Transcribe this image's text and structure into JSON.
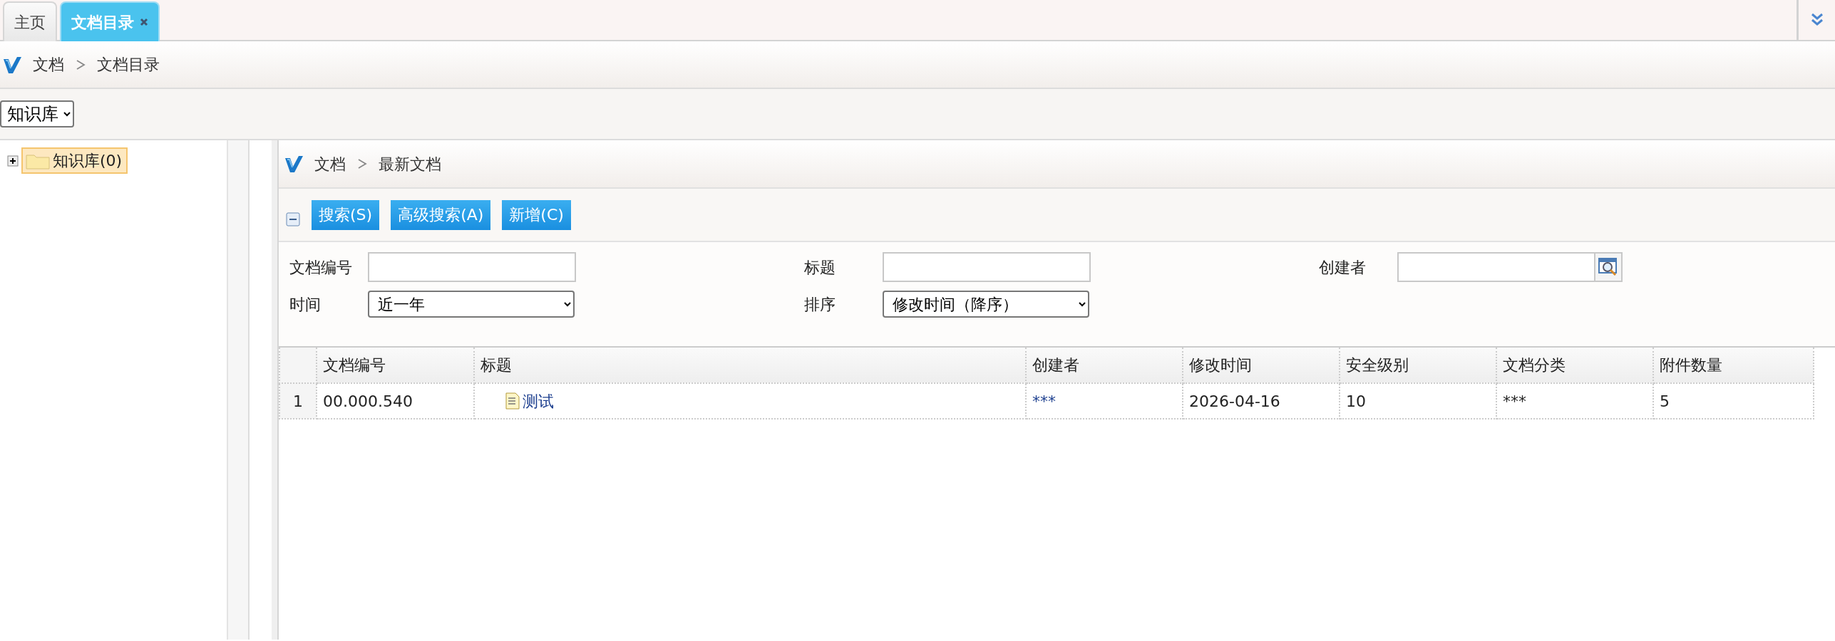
{
  "tabs": [
    {
      "label": "主页",
      "selected": false,
      "closable": false
    },
    {
      "label": "文档目录",
      "selected": true,
      "closable": true
    }
  ],
  "breadcrumb": [
    "文档",
    "文档目录"
  ],
  "library_select": {
    "value": "知识库"
  },
  "tree": [
    {
      "label": "知识库(0)",
      "expanded": false,
      "selected": true
    }
  ],
  "panel": {
    "breadcrumb": [
      "文档",
      "最新文档"
    ],
    "toolbar": {
      "expanded": true,
      "buttons": [
        "搜索(S)",
        "高级搜索(A)",
        "新增(C)"
      ]
    },
    "form": {
      "fields": [
        {
          "label": "文档编号",
          "kind": "text"
        },
        {
          "label": "标题",
          "kind": "text"
        },
        {
          "label": "创建者",
          "kind": "lookup"
        },
        {
          "label": "时间",
          "kind": "select",
          "value": "近一年"
        },
        {
          "label": "排序",
          "kind": "select",
          "value": "修改时间（降序）"
        }
      ]
    },
    "table": {
      "columns": [
        {
          "label": "文档编号",
          "kind": "text"
        },
        {
          "label": "标题",
          "kind": "doc_link"
        },
        {
          "label": "创建者",
          "kind": "link"
        },
        {
          "label": "修改时间",
          "kind": "text"
        },
        {
          "label": "安全级别",
          "kind": "text"
        },
        {
          "label": "文档分类",
          "kind": "text"
        },
        {
          "label": "附件数量",
          "kind": "text"
        }
      ],
      "rows": [
        {
          "number": "1",
          "cells": [
            "00.000.540",
            "测试",
            "***",
            "2026-04-16",
            "10",
            "***",
            "5"
          ]
        }
      ]
    }
  }
}
